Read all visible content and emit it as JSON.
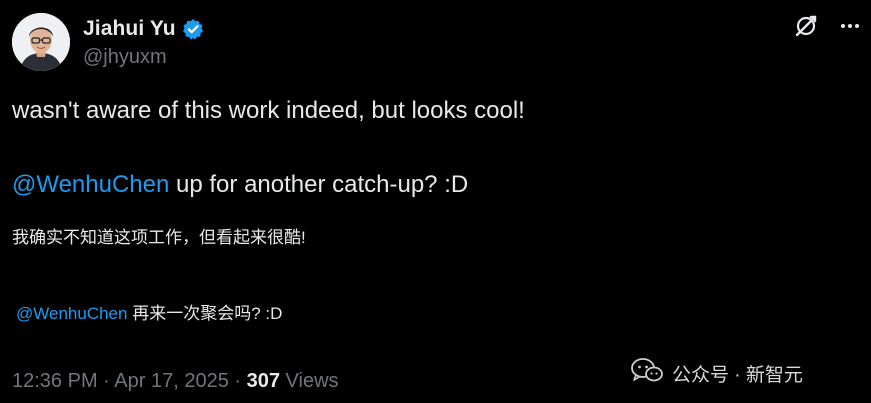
{
  "author": {
    "display_name": "Jiahui Yu",
    "handle": "@jhyuxm",
    "verified": true
  },
  "tweet": {
    "line1": "wasn't aware of this work indeed, but looks cool!",
    "line2_mention": "@WenhuChen",
    "line2_rest": " up for another catch-up? :D",
    "translation_line1": "我确实不知道这项工作，但看起来很酷!",
    "translation_line2_mention": "@WenhuChen",
    "translation_line2_rest": " 再来一次聚会吗? :D"
  },
  "meta": {
    "time": "12:36 PM",
    "separator1": " · ",
    "date": "Apr 17, 2025",
    "separator2": " · ",
    "views_count": "307",
    "views_label": " Views"
  },
  "watermark": {
    "text": "公众号 · 新智元"
  },
  "icons": {
    "verified": "verified-badge-icon",
    "grok": "grok-icon",
    "more": "more-icon",
    "watermark": "wechat-icon"
  },
  "colors": {
    "background": "#000000",
    "text": "#e7e9ea",
    "secondary": "#71767b",
    "accent": "#1d9bf0"
  }
}
